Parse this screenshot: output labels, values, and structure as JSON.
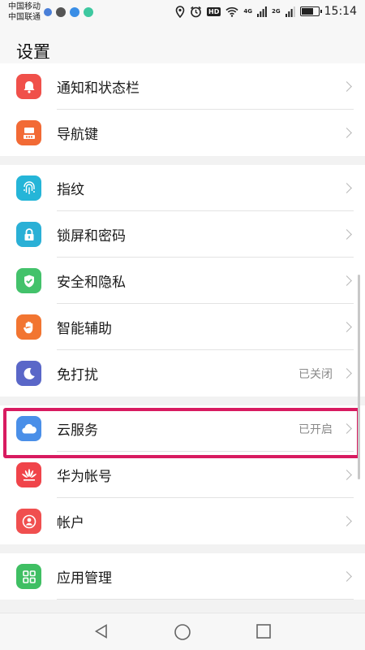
{
  "status_bar": {
    "carrier1": "中国移动",
    "carrier2": "中国联通",
    "hd": "HD",
    "net1": "4G",
    "net2": "2G",
    "time": "15:14"
  },
  "header": {
    "title": "设置"
  },
  "groups": [
    {
      "items": [
        {
          "label": "通知和状态栏",
          "icon": "bell-icon",
          "color": "#f0504a"
        },
        {
          "label": "导航键",
          "icon": "navigation-key-icon",
          "color": "#f26a35"
        }
      ]
    },
    {
      "items": [
        {
          "label": "指纹",
          "icon": "fingerprint-icon",
          "color": "#25b5d8"
        },
        {
          "label": "锁屏和密码",
          "icon": "lock-icon",
          "color": "#2ab0d6"
        },
        {
          "label": "安全和隐私",
          "icon": "shield-check-icon",
          "color": "#43c26b"
        },
        {
          "label": "智能辅助",
          "icon": "hand-icon",
          "color": "#f27531"
        },
        {
          "label": "免打扰",
          "icon": "moon-icon",
          "color": "#5a67c8",
          "status": "已关闭"
        }
      ]
    },
    {
      "items": [
        {
          "label": "云服务",
          "icon": "cloud-icon",
          "color": "#4a8fe8",
          "status": "已开启"
        },
        {
          "label": "华为帐号",
          "icon": "huawei-logo-icon",
          "color": "#f0444a"
        },
        {
          "label": "帐户",
          "icon": "account-icon",
          "color": "#f04f4f"
        }
      ]
    },
    {
      "items": [
        {
          "label": "应用管理",
          "icon": "apps-grid-icon",
          "color": "#3fbf63"
        }
      ]
    }
  ]
}
